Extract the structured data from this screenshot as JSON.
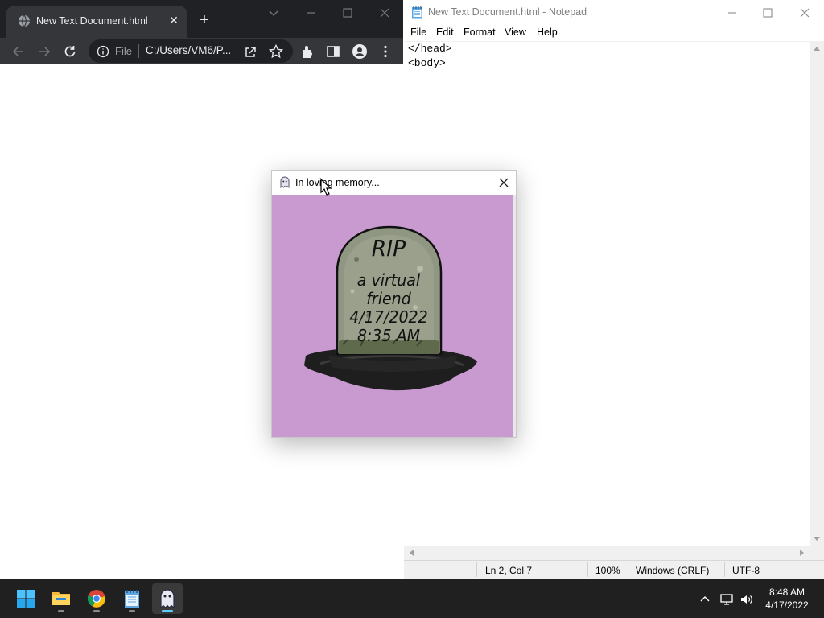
{
  "browser": {
    "tab_title": "New Text Document.html",
    "tab_close": "✕",
    "new_tab": "+",
    "omnibox_scheme": "File",
    "omnibox_url": "C:/Users/VM6/P..."
  },
  "notepad": {
    "title": "New Text Document.html - Notepad",
    "menu": [
      "File",
      "Edit",
      "Format",
      "View",
      "Help"
    ],
    "lines": [
      "</head>",
      "<body>"
    ],
    "status": {
      "position": "Ln 2, Col 7",
      "zoom": "100%",
      "line_ending": "Windows (CRLF)",
      "encoding": "UTF-8"
    }
  },
  "dialog": {
    "title": "In loving memory...",
    "tombstone": {
      "line1": "RIP",
      "line2": "a virtual",
      "line3": "friend",
      "line4": "4/17/2022",
      "line5": "8:35 AM"
    },
    "colors": {
      "background": "#c99ad0",
      "stone": "#8f9682",
      "shadow": "#1e1e1e"
    }
  },
  "taskbar": {
    "apps": [
      "start-icon",
      "file-explorer-icon",
      "chrome-icon",
      "notepad-icon",
      "ghost-app-icon"
    ],
    "time": "8:48 AM",
    "date": "4/17/2022"
  }
}
